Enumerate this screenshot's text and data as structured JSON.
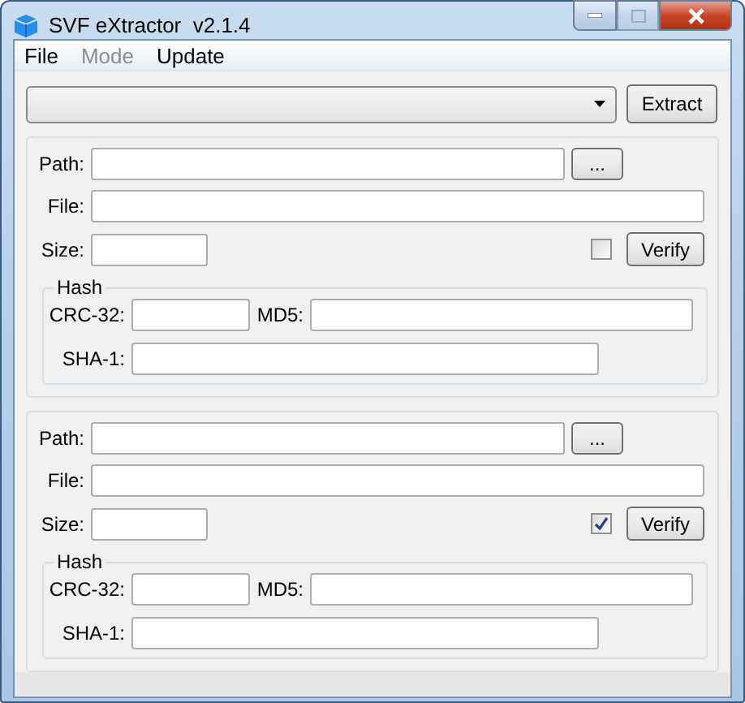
{
  "window": {
    "title": "SVF eXtractor  v2.1.4"
  },
  "menu": [
    {
      "label": "File",
      "disabled": false
    },
    {
      "label": "Mode",
      "disabled": true
    },
    {
      "label": "Update",
      "disabled": false
    }
  ],
  "toolbar": {
    "extract_button": "Extract"
  },
  "panels": [
    {
      "path_label": "Path:",
      "browse_button": "...",
      "file_label": "File:",
      "size_label": "Size:",
      "verify_checked": false,
      "verify_button": "Verify",
      "hash": {
        "title": "Hash",
        "crc_label": "CRC-32:",
        "md5_label": "MD5:",
        "sha1_label": "SHA-1:"
      }
    },
    {
      "path_label": "Path:",
      "browse_button": "...",
      "file_label": "File:",
      "size_label": "Size:",
      "verify_checked": true,
      "verify_button": "Verify",
      "hash": {
        "title": "Hash",
        "crc_label": "CRC-32:",
        "md5_label": "MD5:",
        "sha1_label": "SHA-1:"
      }
    }
  ]
}
